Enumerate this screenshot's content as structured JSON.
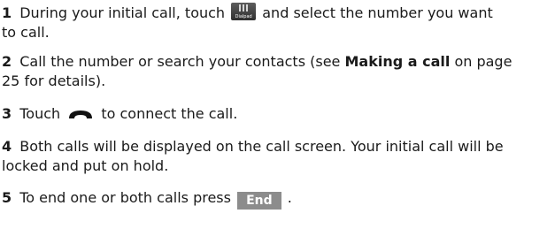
{
  "steps": [
    {
      "num": "1",
      "text_a": "During your initial call, touch",
      "text_b": "and select the number you want",
      "line2": "to call."
    },
    {
      "num": "2",
      "text_a": "Call the number or search your contacts (see",
      "bold": "Making a call",
      "text_b": "on page",
      "line2": "25 for details)."
    },
    {
      "num": "3",
      "text_a": "Touch",
      "text_b": "to connect the call."
    },
    {
      "num": "4",
      "text_a": "Both calls will be displayed on the call screen. Your initial call will be",
      "line2": "locked and put on hold."
    },
    {
      "num": "5",
      "text_a": "To end one or both calls press",
      "text_b": "."
    }
  ],
  "icons": {
    "dialpad_label": "Dialpad",
    "end_label": "End"
  }
}
